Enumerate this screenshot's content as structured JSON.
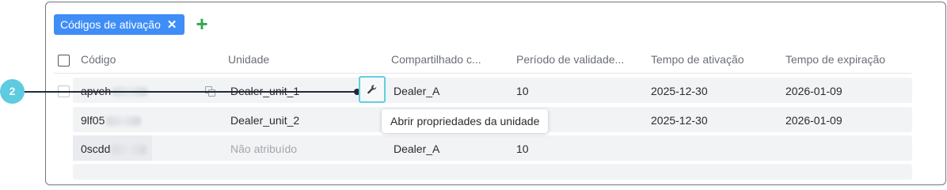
{
  "filter": {
    "chip_label": "Códigos de ativação",
    "remove_glyph": "✕",
    "add_glyph": "+"
  },
  "table": {
    "columns": [
      "Código",
      "Unidade",
      "Compartilhado c...",
      "Período de validade...",
      "Tempo de ativação",
      "Tempo de expiração"
    ],
    "rows": [
      {
        "code": "apveh",
        "unit": "Dealer_unit_1",
        "shared": "Dealer_A",
        "validity": "10",
        "activation": "2025-12-30",
        "expiration": "2026-01-09"
      },
      {
        "code": "9lf05",
        "unit": "Dealer_unit_2",
        "shared": "",
        "validity": "",
        "activation": "2025-12-30",
        "expiration": "2026-01-09"
      },
      {
        "code": "0scdd",
        "unit": "Não atribuído",
        "shared": "Dealer_A",
        "validity": "10",
        "activation": "",
        "expiration": ""
      }
    ]
  },
  "tooltip": "Abrir propriedades da unidade",
  "callout": {
    "number": "2"
  },
  "colors": {
    "chip_bg": "#3f8ef7",
    "add_green": "#2fa84f",
    "highlight_cyan": "#62cfe1",
    "callout_cyan": "#5dcbe0"
  }
}
